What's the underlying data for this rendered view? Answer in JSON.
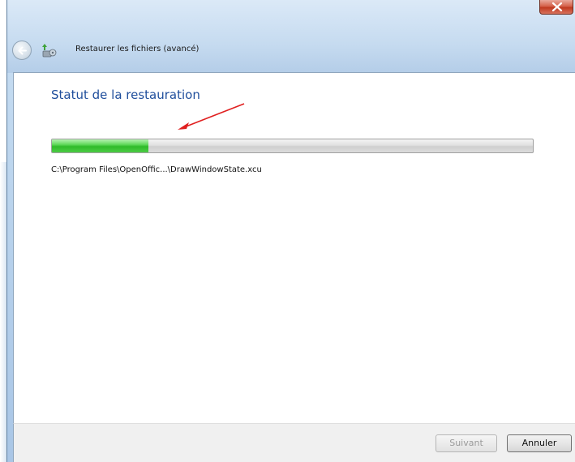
{
  "window": {
    "title": "Restaurer les fichiers (avancé)",
    "icons": {
      "close": "close-icon",
      "back": "back-arrow-icon",
      "app": "restore-files-icon"
    }
  },
  "page": {
    "heading": "Statut de la restauration",
    "progress": {
      "fraction": 0.2
    },
    "current_file": "C:\\Program Files\\OpenOffic...\\DrawWindowState.xcu"
  },
  "buttons": {
    "next_label": "Suivant",
    "next_enabled": false,
    "cancel_label": "Annuler"
  },
  "annotation": {
    "arrow_color": "#e02020"
  }
}
